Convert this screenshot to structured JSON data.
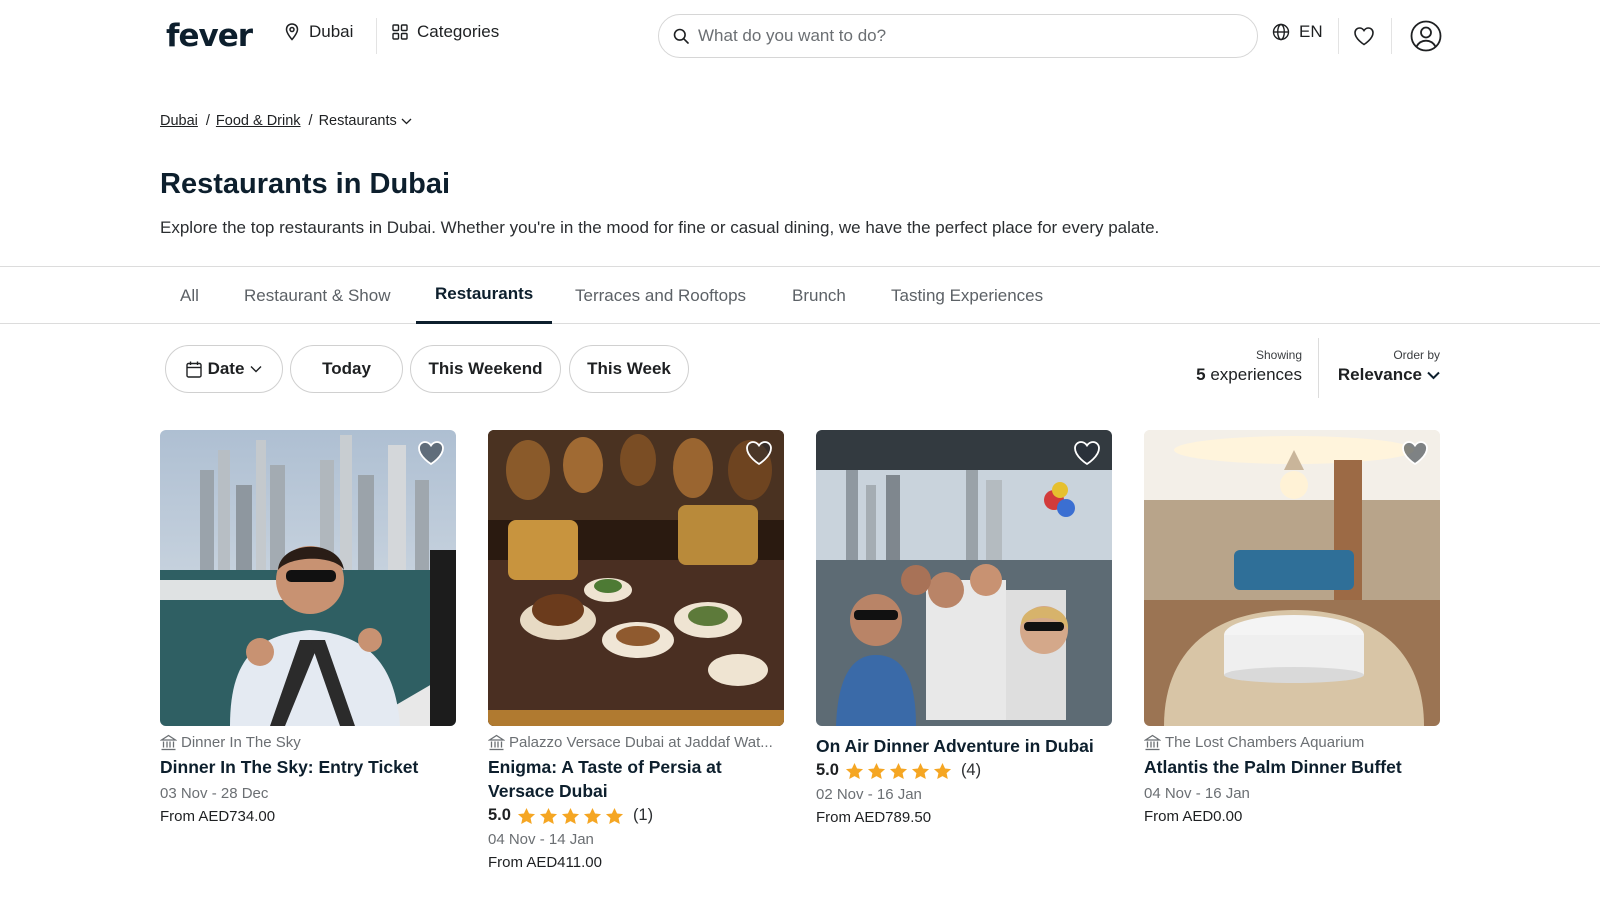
{
  "header": {
    "logo": "fever",
    "city": "Dubai",
    "categories": "Categories",
    "search_placeholder": "What do you want to do?",
    "language": "EN"
  },
  "breadcrumb": {
    "items": [
      "Dubai",
      "Food & Drink"
    ],
    "current": "Restaurants"
  },
  "page": {
    "title": "Restaurants in Dubai",
    "description": "Explore the top restaurants in Dubai. Whether you're in the mood for fine or casual dining, we have the perfect place for every palate."
  },
  "tabs": [
    {
      "label": "All",
      "active": false
    },
    {
      "label": "Restaurant & Show",
      "active": false
    },
    {
      "label": "Restaurants",
      "active": true
    },
    {
      "label": "Terraces and Rooftops",
      "active": false
    },
    {
      "label": "Brunch",
      "active": false
    },
    {
      "label": "Tasting Experiences",
      "active": false
    }
  ],
  "filters": {
    "date": "Date",
    "today": "Today",
    "weekend": "This Weekend",
    "week": "This Week"
  },
  "results": {
    "showing_label": "Showing",
    "count": "5",
    "count_suffix": "experiences",
    "order_label": "Order by",
    "order_value": "Relevance"
  },
  "cards": [
    {
      "venue": "Dinner In The Sky",
      "title": "Dinner In The Sky: Entry Ticket",
      "rating": null,
      "reviews": null,
      "dates": "03 Nov - 28 Dec",
      "price": "From AED734.00"
    },
    {
      "venue": "Palazzo Versace Dubai at Jaddaf Wat...",
      "title": "Enigma: A Taste of Persia at Versace Dubai",
      "rating": "5.0",
      "reviews": "(1)",
      "dates": "04 Nov - 14 Jan",
      "price": "From AED411.00"
    },
    {
      "venue": "",
      "title": "On Air Dinner Adventure in Dubai",
      "rating": "5.0",
      "reviews": "(4)",
      "dates": "02 Nov - 16 Jan",
      "price": "From AED789.50"
    },
    {
      "venue": "The Lost Chambers Aquarium",
      "title": "Atlantis the Palm Dinner Buffet",
      "rating": null,
      "reviews": null,
      "dates": "04 Nov - 16 Jan",
      "price": "From AED0.00"
    }
  ],
  "colors": {
    "star": "#f5a623",
    "brand_dark": "#0d1f2d"
  }
}
